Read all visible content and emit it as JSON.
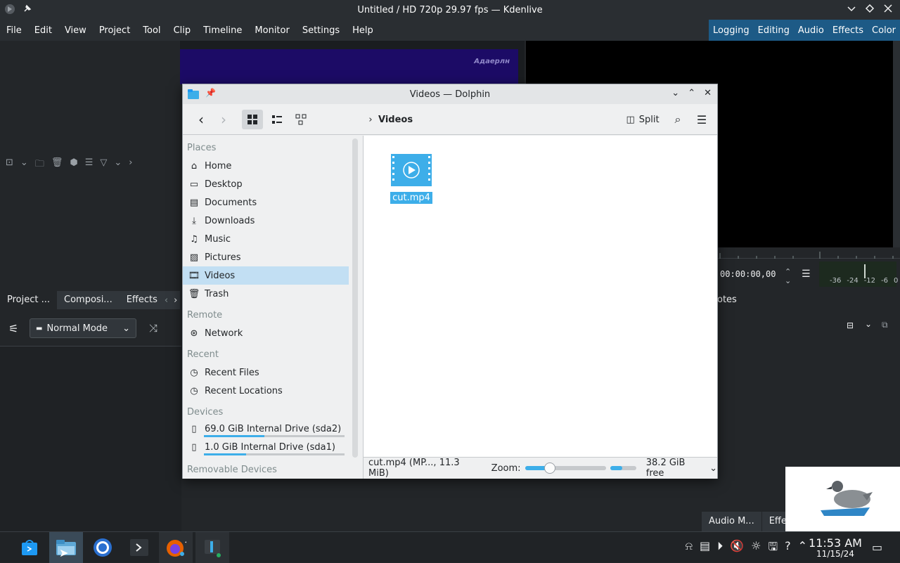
{
  "kdenlive": {
    "title": "Untitled / HD 720p 29.97 fps — Kdenlive",
    "menu": [
      "File",
      "Edit",
      "View",
      "Project",
      "Tool",
      "Clip",
      "Timeline",
      "Monitor",
      "Settings",
      "Help"
    ],
    "workspaces": [
      "Logging",
      "Editing",
      "Audio",
      "Effects",
      "Color"
    ],
    "preview_watermark": "Адаерлн",
    "timecode": "00:00:00,00",
    "meter_labels": [
      "-36",
      "-24",
      "-12",
      "-6",
      "0"
    ],
    "tabs": [
      "Project ...",
      "Composi...",
      "Effects"
    ],
    "notes_tab": "otes",
    "mode_select": "Normal Mode",
    "bottom_tabs": [
      "Audio M...",
      "Effec"
    ]
  },
  "dolphin": {
    "title": "Videos — Dolphin",
    "breadcrumb": "Videos",
    "split_label": "Split",
    "places": {
      "places_header": "Places",
      "home": "Home",
      "desktop": "Desktop",
      "documents": "Documents",
      "downloads": "Downloads",
      "music": "Music",
      "pictures": "Pictures",
      "videos": "Videos",
      "trash": "Trash",
      "remote_header": "Remote",
      "network": "Network",
      "recent_header": "Recent",
      "recent_files": "Recent Files",
      "recent_locations": "Recent Locations",
      "devices_header": "Devices",
      "drive1": "69.0 GiB Internal Drive (sda2)",
      "drive1_used_fraction": 0.43,
      "drive2": "1.0 GiB Internal Drive (sda1)",
      "drive2_used_fraction": 0.3,
      "removable_header": "Removable Devices"
    },
    "file_name": "cut.mp4",
    "status_file": "cut.mp4 (MP..., 11.3 MiB)",
    "zoom_label": "Zoom:",
    "free_space": "38.2 GiB free"
  },
  "taskbar": {
    "time": "11:53 AM",
    "date": "11/15/24"
  }
}
